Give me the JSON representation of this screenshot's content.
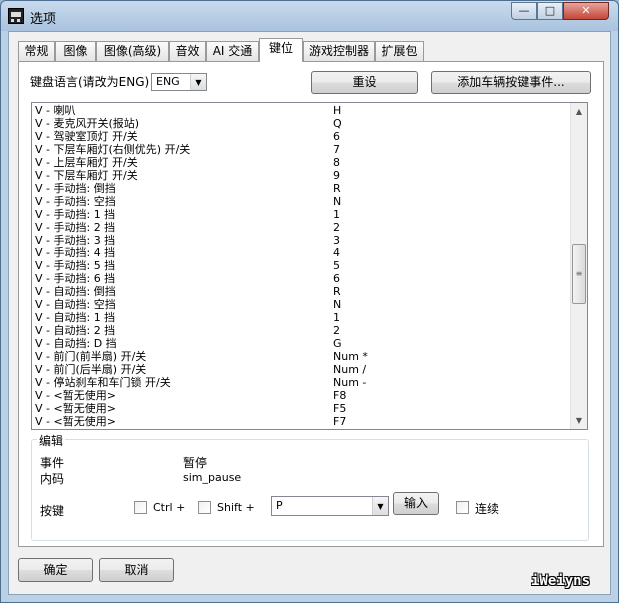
{
  "window": {
    "title": "选项",
    "controls": {
      "minimize": "—",
      "maximize": "□",
      "close": "✕"
    },
    "app_icon": "bus-icon"
  },
  "tabs": [
    "常规",
    "图像",
    "图像(高级)",
    "音效",
    "AI 交通",
    "键位",
    "游戏控制器",
    "扩展包"
  ],
  "active_tab": "键位",
  "top": {
    "lang_label": "键盘语言(请改为ENG)",
    "lang_value": "ENG",
    "reset_button": "重设",
    "add_event_button": "添加车辆按键事件..."
  },
  "keys": [
    {
      "name": "V - 喇叭",
      "key": "H"
    },
    {
      "name": "V - 麦克风开关(报站)",
      "key": "Q"
    },
    {
      "name": "V - 驾驶室顶灯 开/关",
      "key": "6"
    },
    {
      "name": "V - 下层车厢灯(右侧优先) 开/关",
      "key": "7"
    },
    {
      "name": "V - 上层车厢灯 开/关",
      "key": "8"
    },
    {
      "name": "V - 下层车厢灯 开/关",
      "key": "9"
    },
    {
      "name": "V - 手动挡: 倒挡",
      "key": "R"
    },
    {
      "name": "V - 手动挡: 空挡",
      "key": "N"
    },
    {
      "name": "V - 手动挡: 1 挡",
      "key": "1"
    },
    {
      "name": "V - 手动挡: 2 挡",
      "key": "2"
    },
    {
      "name": "V - 手动挡: 3 挡",
      "key": "3"
    },
    {
      "name": "V - 手动挡: 4 挡",
      "key": "4"
    },
    {
      "name": "V - 手动挡: 5 挡",
      "key": "5"
    },
    {
      "name": "V - 手动挡: 6 挡",
      "key": "6"
    },
    {
      "name": "V - 自动挡: 倒挡",
      "key": "R"
    },
    {
      "name": "V - 自动挡: 空挡",
      "key": "N"
    },
    {
      "name": "V - 自动挡: 1 挡",
      "key": "1"
    },
    {
      "name": "V - 自动挡: 2 挡",
      "key": "2"
    },
    {
      "name": "V - 自动挡: D 挡",
      "key": "G"
    },
    {
      "name": "V - 前门(前半扇) 开/关",
      "key": "Num *"
    },
    {
      "name": "V - 前门(后半扇) 开/关",
      "key": "Num /"
    },
    {
      "name": "V - 停站刹车和车门锁 开/关",
      "key": "Num -"
    },
    {
      "name": "V - <暂无使用>",
      "key": "F8"
    },
    {
      "name": "V - <暂无使用>",
      "key": "F5"
    },
    {
      "name": "V - <暂无使用>",
      "key": "F7"
    }
  ],
  "edit": {
    "group_title": "编辑",
    "event_label": "事件",
    "event_value": "暂停",
    "code_label": "内码",
    "code_value": "sim_pause",
    "key_label": "按键",
    "ctrl_label": "Ctrl +",
    "shift_label": "Shift +",
    "key_value": "P",
    "input_button": "输入",
    "continuous_label": "连续"
  },
  "footer": {
    "ok_button": "确定",
    "cancel_button": "取消",
    "watermark": "iWeiyns"
  }
}
